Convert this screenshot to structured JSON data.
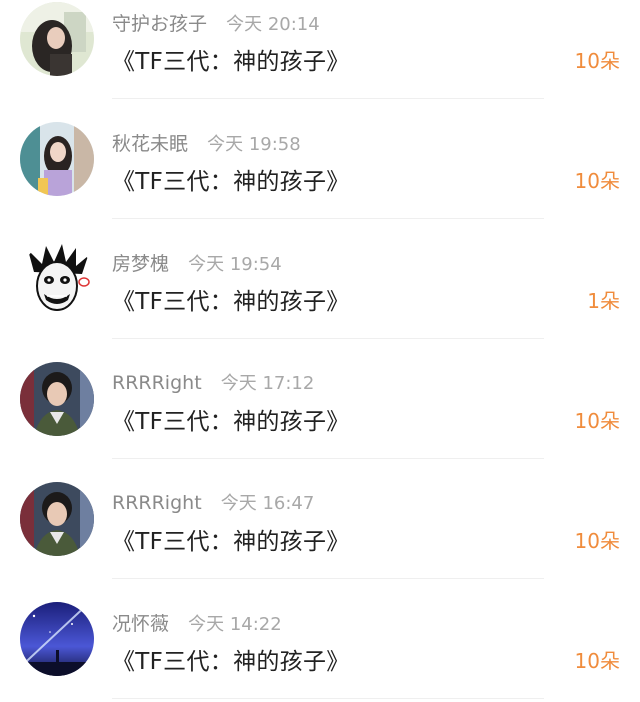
{
  "feed": {
    "items": [
      {
        "username": "守护お孩子",
        "time": "今天 20:14",
        "title": "《TF三代：神的孩子》",
        "amount": "10朵",
        "avatar_icon": "avatar-girl-photo"
      },
      {
        "username": "秋花未眠",
        "time": "今天 19:58",
        "title": "《TF三代：神的孩子》",
        "amount": "10朵",
        "avatar_icon": "avatar-girl-photo"
      },
      {
        "username": "房梦槐",
        "time": "今天 19:54",
        "title": "《TF三代：神的孩子》",
        "amount": "1朵",
        "avatar_icon": "avatar-cartoon-face"
      },
      {
        "username": "RRRRight",
        "time": "今天 17:12",
        "title": "《TF三代：神的孩子》",
        "amount": "10朵",
        "avatar_icon": "avatar-boy-photo"
      },
      {
        "username": "RRRRight",
        "time": "今天 16:47",
        "title": "《TF三代：神的孩子》",
        "amount": "10朵",
        "avatar_icon": "avatar-boy-photo"
      },
      {
        "username": "况怀薇",
        "time": "今天 14:22",
        "title": "《TF三代：神的孩子》",
        "amount": "10朵",
        "avatar_icon": "avatar-night-sky"
      }
    ],
    "accent_color": "#f08c3c"
  }
}
